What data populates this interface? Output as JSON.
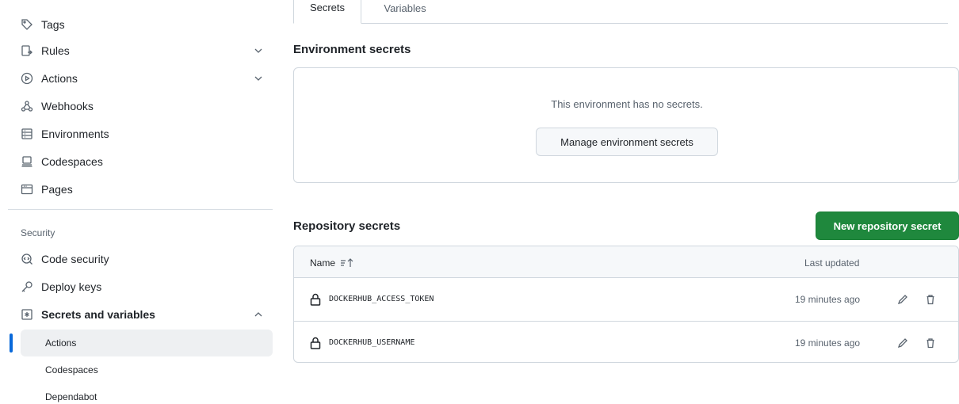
{
  "sidebar": {
    "items": [
      {
        "label": "Tags",
        "icon": "tag-icon"
      },
      {
        "label": "Rules",
        "icon": "rules-icon"
      },
      {
        "label": "Actions",
        "icon": "play-icon"
      },
      {
        "label": "Webhooks",
        "icon": "webhook-icon"
      },
      {
        "label": "Environments",
        "icon": "server-icon"
      },
      {
        "label": "Codespaces",
        "icon": "codespaces-icon"
      },
      {
        "label": "Pages",
        "icon": "browser-icon"
      }
    ],
    "security_heading": "Security",
    "security_items": [
      {
        "label": "Code security",
        "icon": "codescan-icon"
      },
      {
        "label": "Deploy keys",
        "icon": "key-icon"
      },
      {
        "label": "Secrets and variables",
        "icon": "key-asterisk-icon"
      }
    ],
    "sub_items": [
      {
        "label": "Actions",
        "active": true
      },
      {
        "label": "Codespaces",
        "active": false
      },
      {
        "label": "Dependabot",
        "active": false
      }
    ]
  },
  "tabs": [
    {
      "label": "Secrets",
      "selected": true
    },
    {
      "label": "Variables",
      "selected": false
    }
  ],
  "environment": {
    "heading": "Environment secrets",
    "empty_text": "This environment has no secrets.",
    "manage_button": "Manage environment secrets"
  },
  "repository": {
    "heading": "Repository secrets",
    "new_button": "New repository secret",
    "columns": {
      "name": "Name",
      "updated": "Last updated"
    },
    "rows": [
      {
        "name": "DOCKERHUB_ACCESS_TOKEN",
        "updated": "19 minutes ago"
      },
      {
        "name": "DOCKERHUB_USERNAME",
        "updated": "19 minutes ago"
      }
    ]
  },
  "colors": {
    "accent": "#0969da",
    "primary_button": "#1f883d",
    "border": "#d0d7de",
    "muted_text": "#59636e"
  }
}
